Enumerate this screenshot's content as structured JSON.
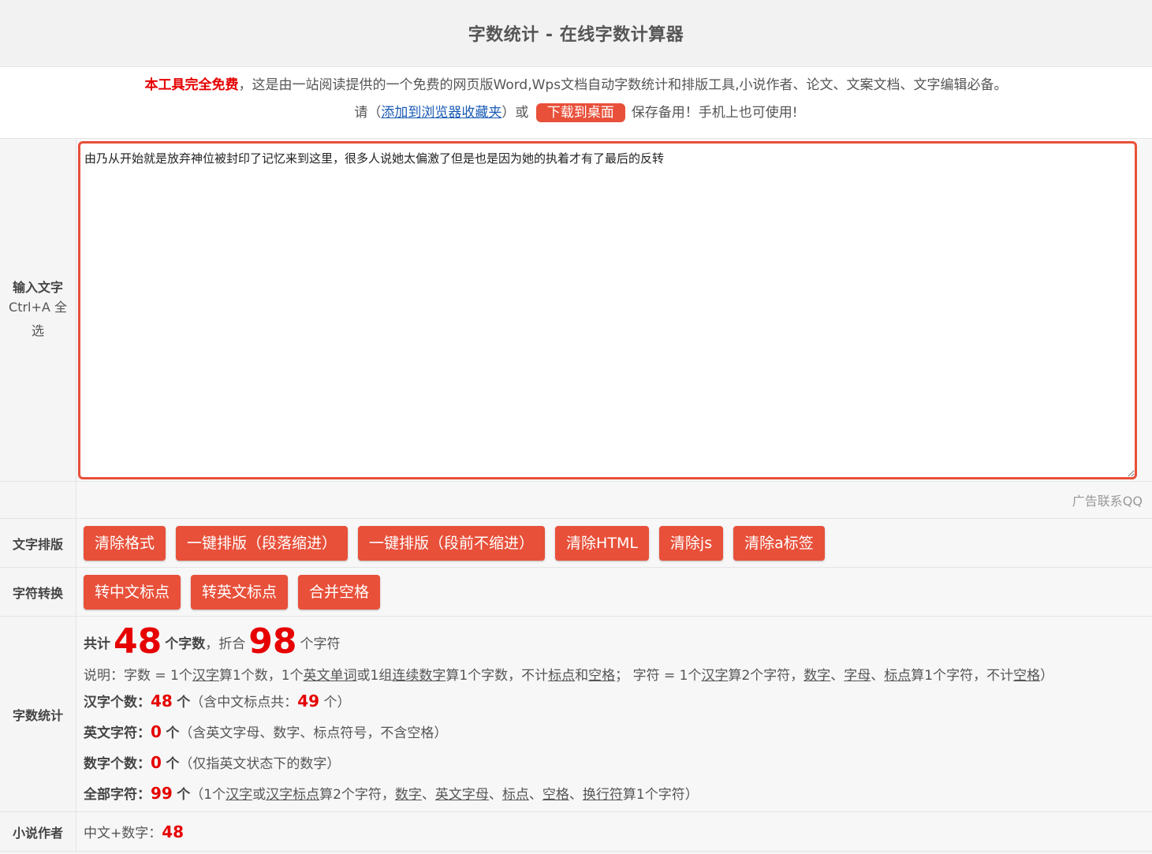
{
  "header": {
    "title": "字数统计 - 在线字数计算器"
  },
  "intro": {
    "free_text": "本工具完全免费",
    "line1_rest": "，这是由一站阅读提供的一个免费的网页版Word,Wps文档自动字数统计和排版工具,小说作者、论文、文案文档、文字编辑必备。",
    "please": "请（",
    "bookmark_link": "添加到浏览器收藏夹",
    "or": "）或",
    "download_button": "下载到桌面",
    "save_text": "保存备用！手机上也可使用!"
  },
  "input": {
    "label_title": "输入文字",
    "label_hint": "Ctrl+A 全选",
    "text": "由乃从开始就是放弃神位被封印了记忆来到这里，很多人说她太偏激了但是也是因为她的执着才有了最后的反转"
  },
  "ad": {
    "text": "广告联系QQ"
  },
  "format": {
    "label": "文字排版",
    "buttons": [
      "清除格式",
      "一键排版（段落缩进）",
      "一键排版（段前不缩进）",
      "清除HTML",
      "清除js",
      "清除a标签"
    ]
  },
  "convert": {
    "label": "字符转换",
    "buttons": [
      "转中文标点",
      "转英文标点",
      "合并空格"
    ]
  },
  "stats": {
    "label": "字数统计",
    "total_prefix": "共计",
    "word_count": "48",
    "word_unit": "个字数",
    "sep": "，折合",
    "char_count": "98",
    "char_unit": "个字符",
    "note": {
      "p1": "说明：字数 = 1个",
      "u1": "汉字",
      "p2": "算1个数，1个",
      "u2": "英文单词",
      "p3": "或1组",
      "u3": "连续数字",
      "p4": "算1个字数，不计",
      "u4": "标点",
      "p5": "和",
      "u5": "空格",
      "p6": "； 字符 = 1个",
      "u6": "汉字",
      "p7": "算2个字符，",
      "u7": "数字",
      "p8": "、",
      "u8": "字母",
      "p9": "、",
      "u9": "标点",
      "p10": "算1个字符，不计",
      "u10": "空格",
      "p11": "）"
    },
    "hanzi": {
      "key": "汉字个数：",
      "value": "48",
      "unit": "个",
      "extra_prefix": "（含中文标点共：",
      "extra_value": "49",
      "extra_suffix": "个）"
    },
    "english": {
      "key": "英文字符：",
      "value": "0",
      "unit": "个",
      "desc": "（含英文字母、数字、标点符号，不含空格）"
    },
    "digits": {
      "key": "数字个数：",
      "value": "0",
      "unit": "个",
      "desc": "（仅指英文状态下的数字）"
    },
    "all": {
      "key": "全部字符：",
      "value": "99",
      "unit": "个",
      "d1": "（1个",
      "u1": "汉字",
      "d2": "或",
      "u2": "汉字标点",
      "d3": "算2个字符，",
      "u3": "数字",
      "d4": "、",
      "u4": "英文字母",
      "d5": "、",
      "u5": "标点",
      "d6": "、",
      "u6": "空格",
      "d7": "、",
      "u7": "换行符",
      "d8": "算1个字符）"
    }
  },
  "novel": {
    "label": "小说作者",
    "text": "中文+数字：",
    "value": "48"
  },
  "colors": {
    "accent": "#e8503a",
    "red": "#e60000",
    "link": "#1a5bb5"
  }
}
